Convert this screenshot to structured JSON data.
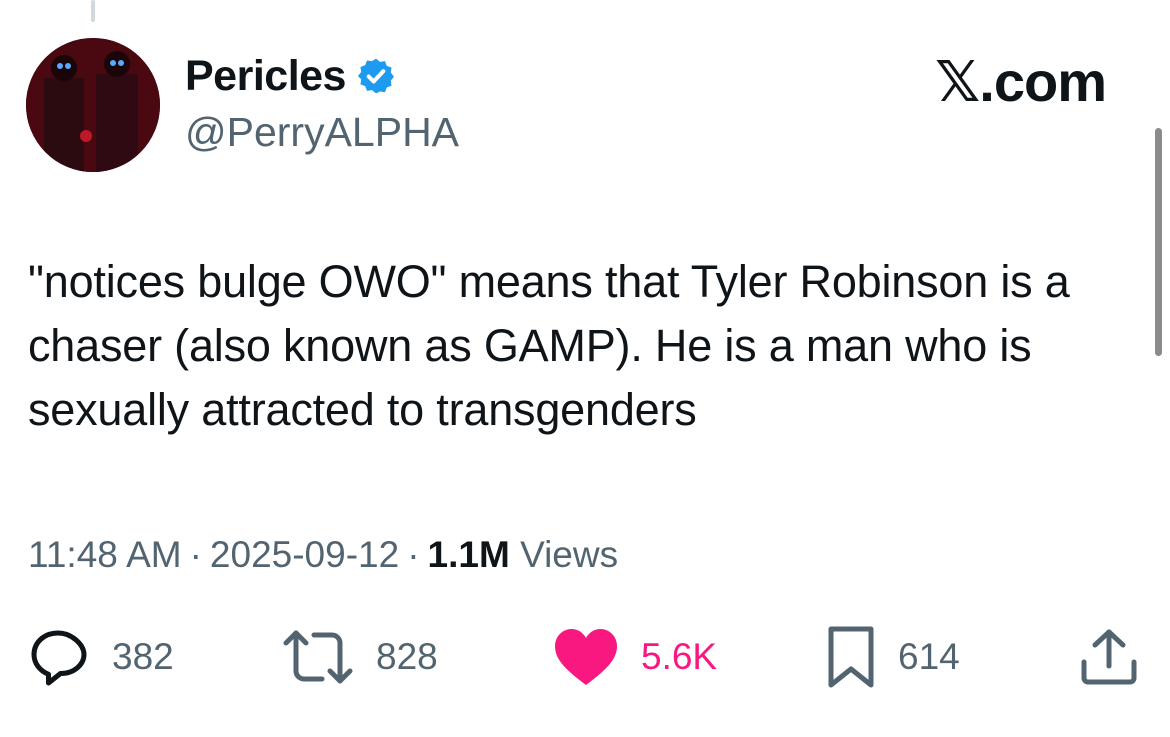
{
  "brand": "𝕏.com",
  "author": {
    "name": "Pericles",
    "handle": "@PerryALPHA",
    "verified": true,
    "verified_color": "#1d9bf0"
  },
  "tweet": {
    "text": "\"notices bulge OWO\" means that Tyler Robinson is a chaser (also known as GAMP). He is a man who is sexually attracted to transgenders"
  },
  "meta": {
    "time": "11:48 AM",
    "separator": "·",
    "date": "2025-09-12",
    "views_count": "1.1M",
    "views_label": "Views"
  },
  "actions": {
    "replies": "382",
    "reposts": "828",
    "likes": "5.6K",
    "bookmarks": "614"
  },
  "icons": {
    "reply": "speech-bubble-icon",
    "repost": "repost-arrows-icon",
    "like": "heart-icon",
    "bookmark": "bookmark-icon",
    "share": "share-upload-icon"
  },
  "colors": {
    "text": "#0f1419",
    "secondary": "#536471",
    "like": "#f91880"
  }
}
